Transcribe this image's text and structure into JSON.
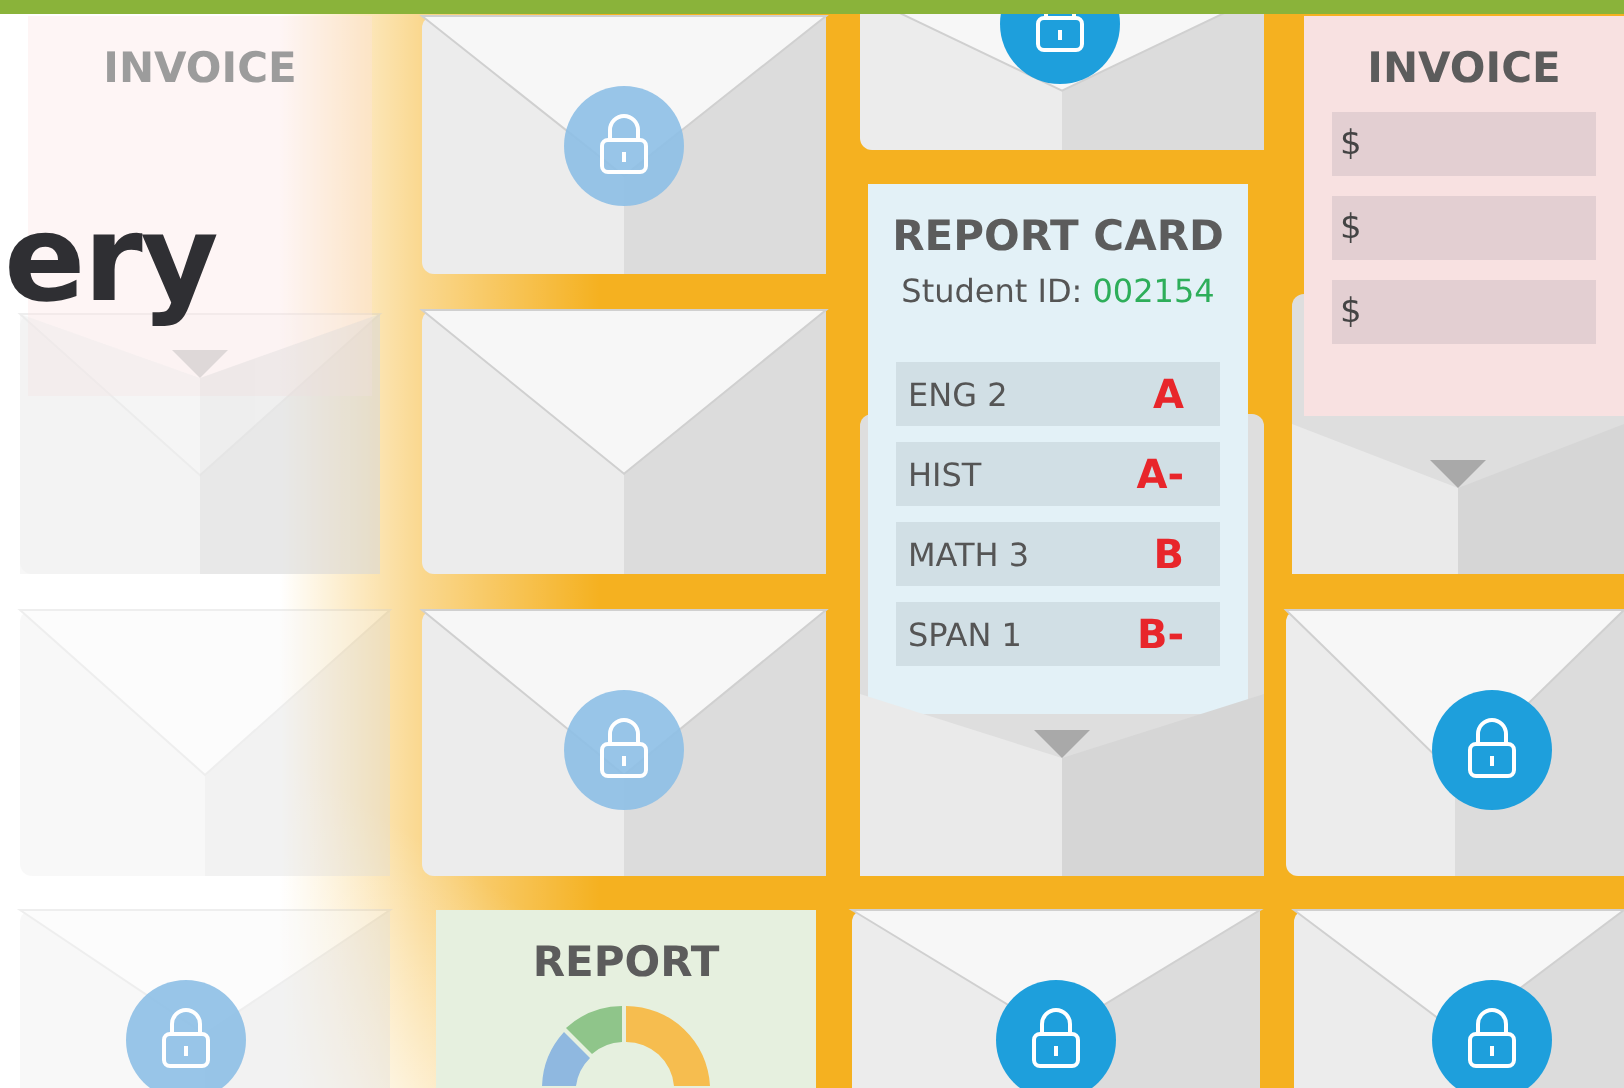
{
  "headline": "ery",
  "invoices": [
    {
      "title": "INVOICE",
      "faded": true
    },
    {
      "title": "INVOICE",
      "faded": false,
      "fields": [
        "$",
        "$",
        "$"
      ]
    }
  ],
  "report_card": {
    "title": "REPORT CARD",
    "id_label": "Student ID:",
    "id_value": "002154",
    "grades": [
      {
        "subject": "ENG 2",
        "grade": "A"
      },
      {
        "subject": "HIST",
        "grade": "A-"
      },
      {
        "subject": "MATH 3",
        "grade": "B"
      },
      {
        "subject": "SPAN 1",
        "grade": "B-"
      }
    ]
  },
  "report": {
    "title": "REPORT"
  }
}
